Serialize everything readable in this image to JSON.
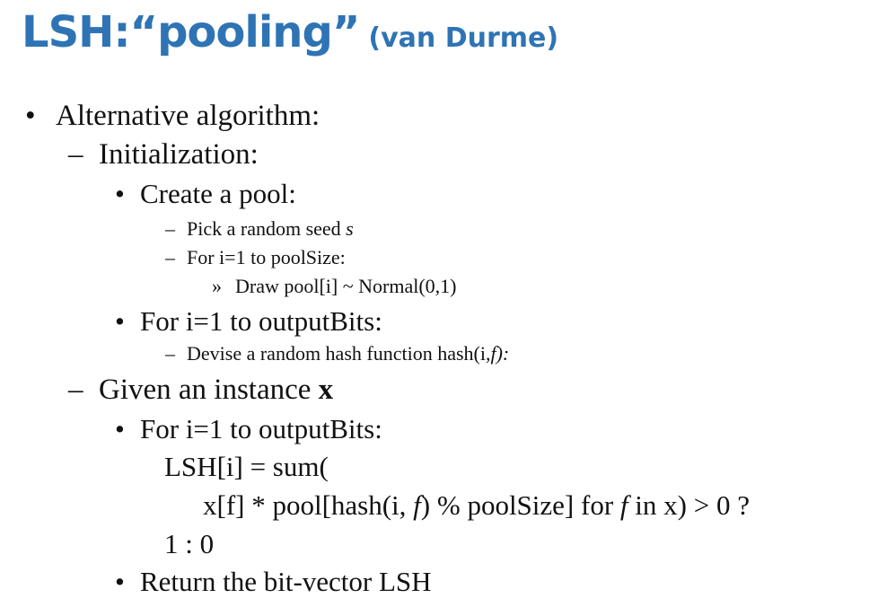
{
  "slide": {
    "title": {
      "main": "LSH:“pooling”",
      "attribution": "(van Durme)"
    },
    "markers": {
      "bullet": "•",
      "dash": "–",
      "raquo": "»"
    },
    "items": {
      "alt_algorithm": "Alternative algorithm:",
      "initialization": "Initialization:",
      "create_pool": "Create a pool:",
      "pick_seed_text": "Pick a random seed ",
      "pick_seed_var": "s",
      "for_pool_size": "For i=1 to poolSize:",
      "draw_pool": "Draw pool[i] ~ Normal(0,1)",
      "for_output_bits_1": "For i=1 to outputBits:",
      "devise_hash_text": "Devise a random hash function hash(i,",
      "devise_hash_var": "f",
      "devise_hash_end": "):",
      "given_instance_text": "Given an instance ",
      "given_instance_var": "x",
      "for_output_bits_2": "For i=1 to outputBits:",
      "code_line1": "LSH[i] = sum(",
      "code_line2_a": "x[f] * pool[hash(i, ",
      "code_line2_f1": "f",
      "code_line2_b": ") % poolSize] for ",
      "code_line2_f2": "f",
      "code_line2_c": " in x) > 0 ?",
      "code_line3": "1 : 0",
      "return_line": "Return the bit-vector LSH"
    }
  }
}
